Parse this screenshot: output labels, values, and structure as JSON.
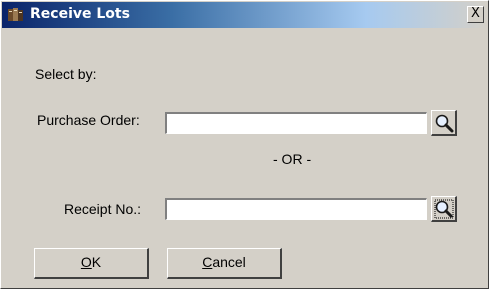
{
  "window": {
    "title": "Receive Lots",
    "close_label": "X"
  },
  "form": {
    "select_by_label": "Select by:",
    "purchase_order_label": "Purchase Order:",
    "purchase_order_value": "",
    "or_label": "- OR -",
    "receipt_no_label": "Receipt No.:",
    "receipt_no_value": ""
  },
  "buttons": {
    "ok": {
      "mnemonic": "O",
      "rest": "K"
    },
    "cancel": {
      "mnemonic": "C",
      "rest": "ancel"
    }
  },
  "icons": {
    "app": "dialog-app-icon",
    "lookup_purchase_order": "magnifier-icon",
    "lookup_receipt": "magnifier-icon"
  },
  "colors": {
    "title_gradient_start": "#0a246a",
    "title_gradient_end": "#d4d0c8",
    "dialog_face": "#d4d0c8"
  }
}
